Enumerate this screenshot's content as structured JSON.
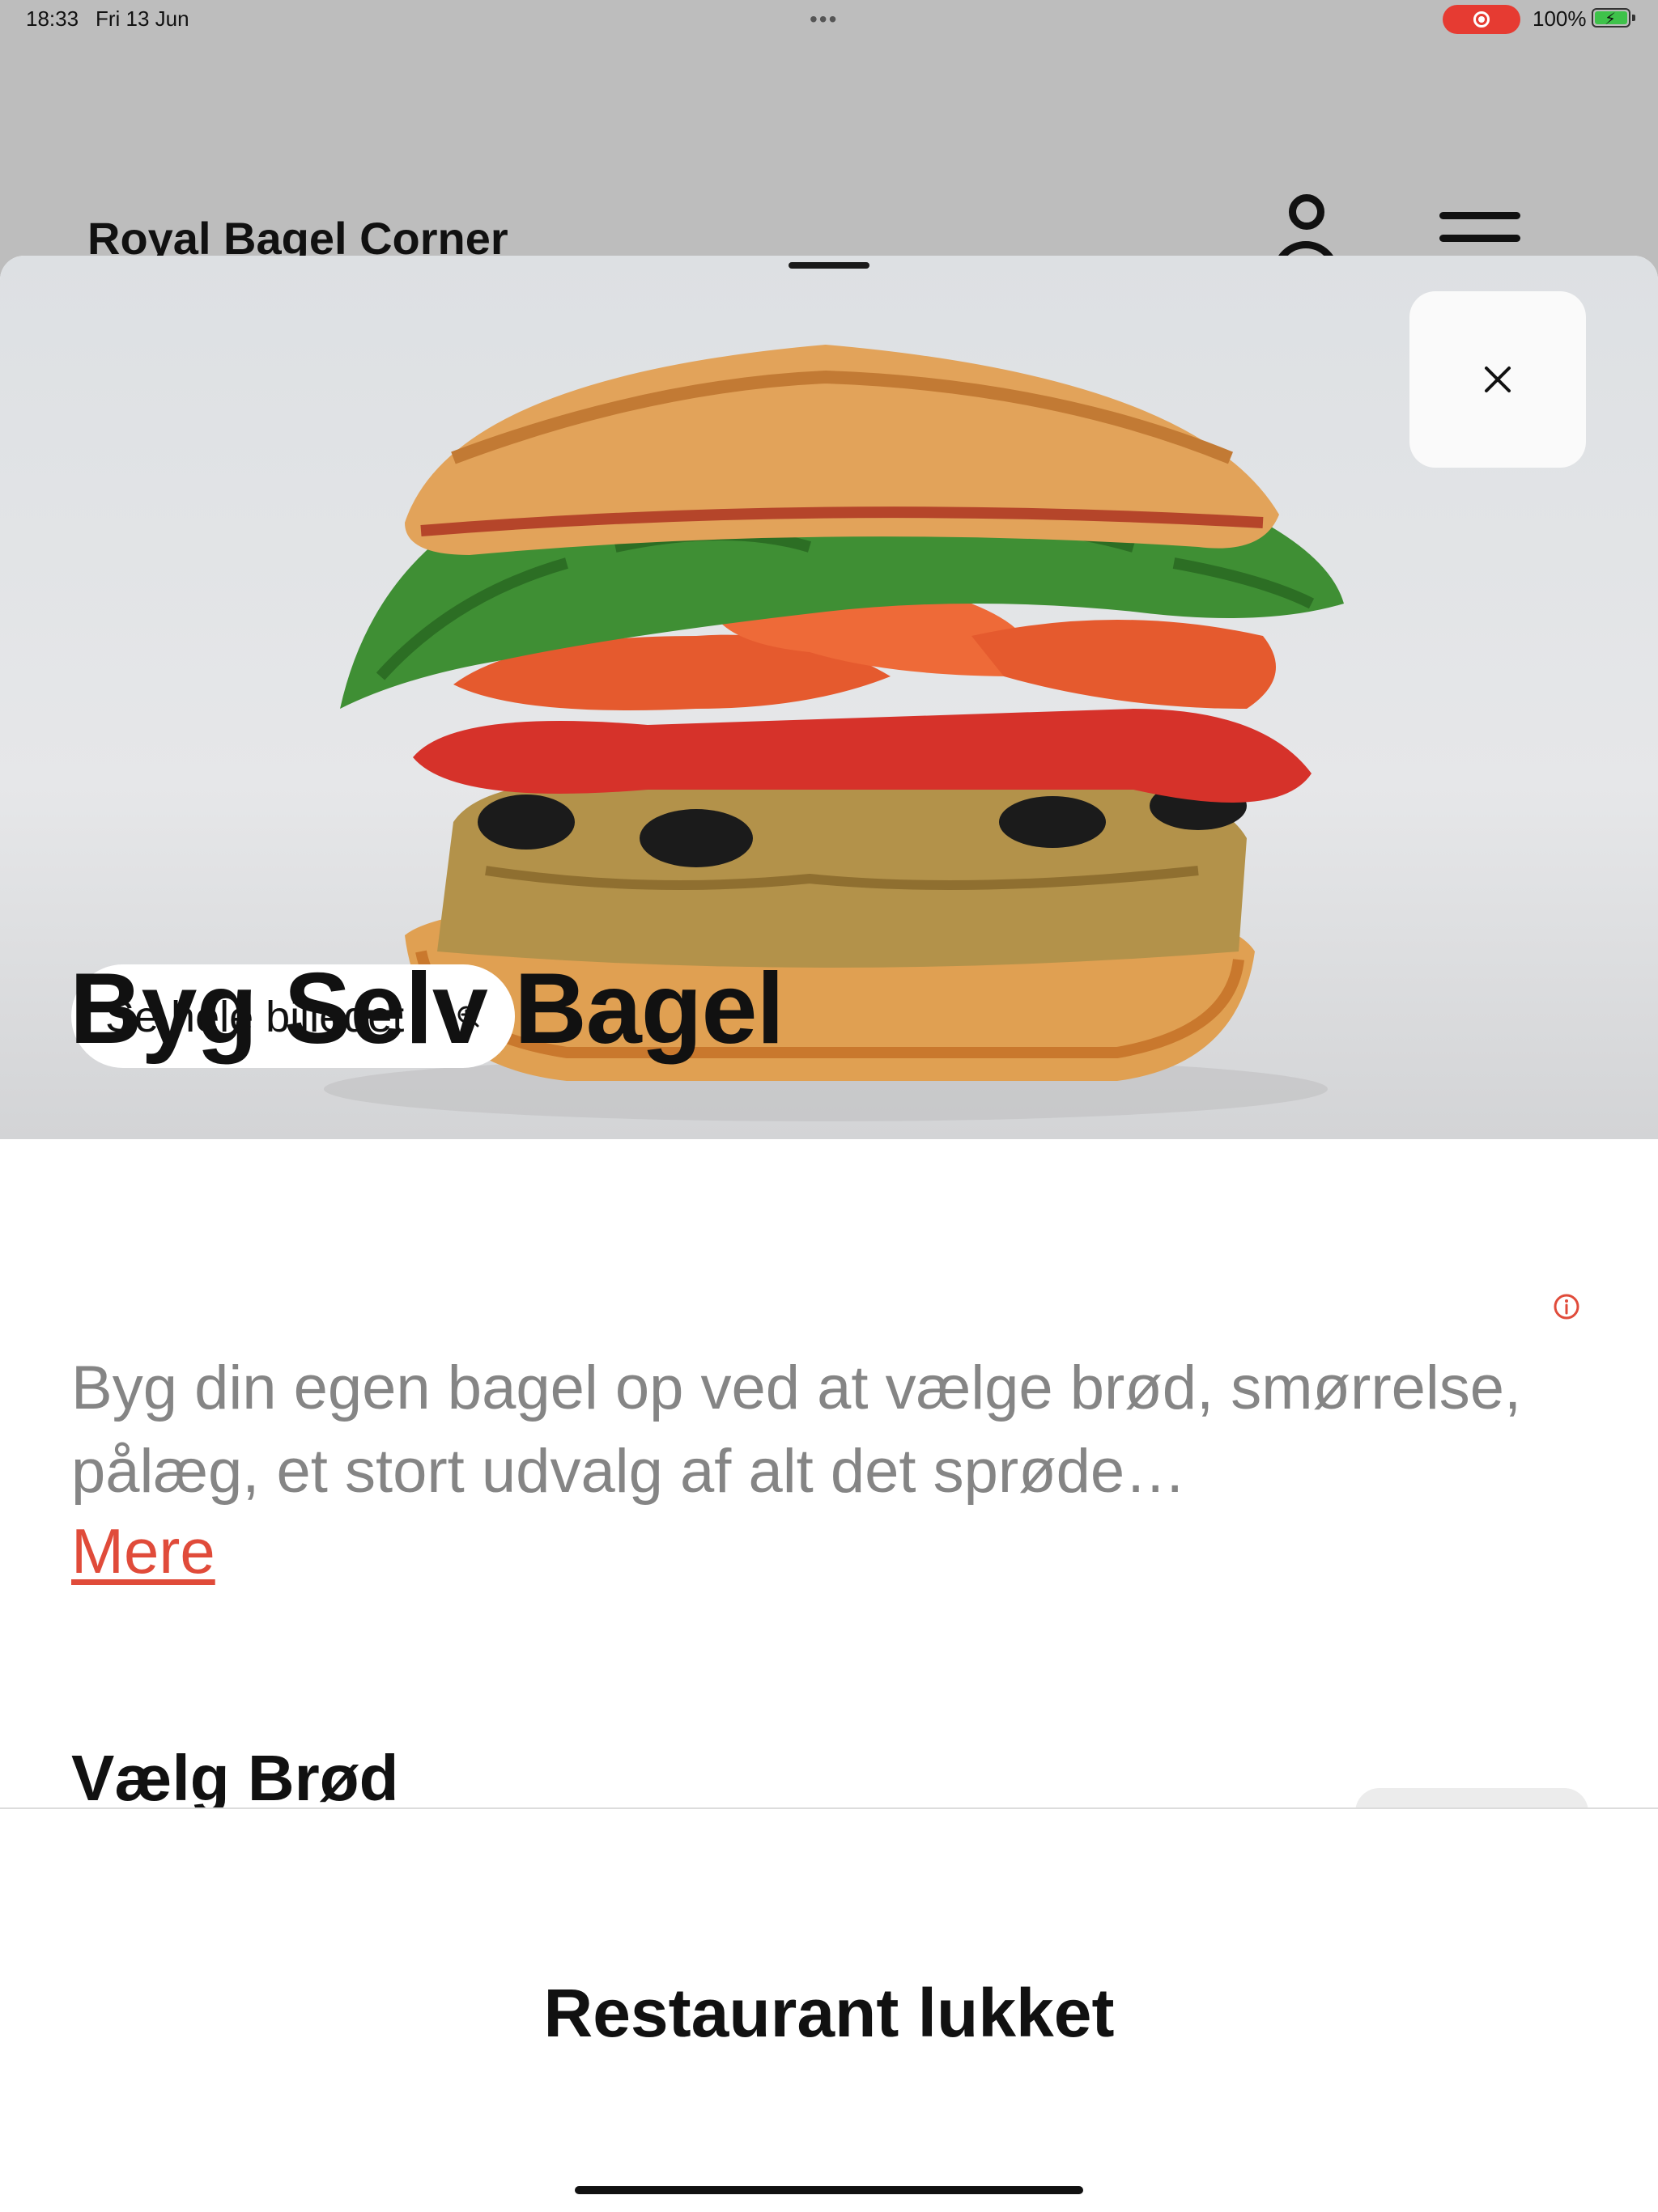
{
  "status_bar": {
    "time": "18:33",
    "date": "Fri 13 Jun",
    "battery": "100%",
    "recording_color": "#e63b32"
  },
  "header": {
    "title": "Royal Bagel Corner",
    "profile_icon": "user-icon",
    "menu_icon": "menu-icon"
  },
  "hero": {
    "image_subject": "bagel-sandwich",
    "close_icon": "close-icon",
    "see_full_label": "Se hele billedet",
    "zoom_icon": "zoom-in-icon"
  },
  "product": {
    "title": "Byg Selv Bagel",
    "description": "Byg din egen bagel op ved at vælge brød, smørrelse, pålæg, et stort udvalg af alt det sprøde…",
    "more_label": "Mere",
    "info_icon": "info-icon",
    "accent_color": "#e04b3a"
  },
  "section": {
    "title": "Vælg Brød"
  },
  "footer": {
    "status": "Restaurant lukket"
  }
}
